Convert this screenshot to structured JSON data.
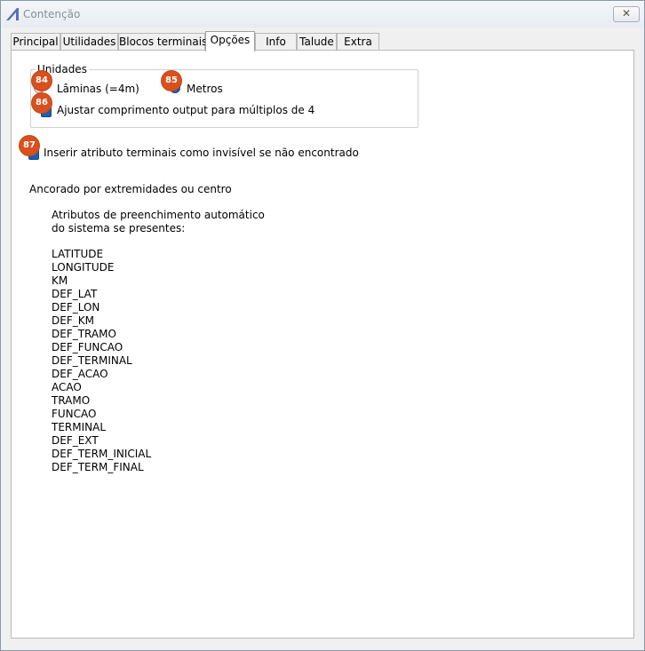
{
  "window": {
    "title": "Contenção",
    "close_label": "✕"
  },
  "tabs": [
    {
      "label": "Principal"
    },
    {
      "label": "Utilidades"
    },
    {
      "label": "Blocos terminais"
    },
    {
      "label": "Opções"
    },
    {
      "label": "Info"
    },
    {
      "label": "Talude"
    },
    {
      "label": "Extra"
    }
  ],
  "active_tab": "Opções",
  "unidades": {
    "legend": "Unidades",
    "option_laminas": "Lâminas (=4m)",
    "option_metros": "Metros",
    "adjust_label": "Ajustar comprimento output para múltiplos de 4"
  },
  "insert_invisible_label": "Inserir atributo terminais como invisível se não encontrado",
  "anchor_text": "Ancorado por extremidades ou centro",
  "autofill_heading_line1": "Atributos de preenchimento automático",
  "autofill_heading_line2": "do sistema se presentes:",
  "attributes": [
    "LATITUDE",
    "LONGITUDE",
    "KM",
    "DEF_LAT",
    "DEF_LON",
    "DEF_KM",
    "DEF_TRAMO",
    "DEF_FUNCAO",
    "DEF_TERMINAL",
    "DEF_ACAO",
    "ACAO",
    "TRAMO",
    "FUNCAO",
    "TERMINAL",
    "DEF_EXT",
    "DEF_TERM_INICIAL",
    "DEF_TERM_FINAL"
  ],
  "markers": [
    "84",
    "85",
    "86",
    "87"
  ],
  "colors": {
    "accent": "#1a5fb4",
    "marker": "#d9501e"
  }
}
